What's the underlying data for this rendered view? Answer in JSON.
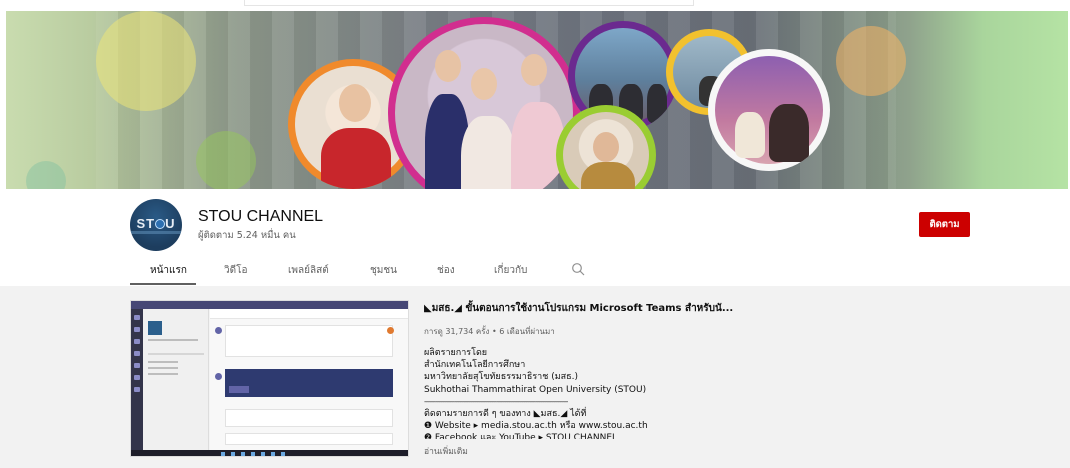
{
  "channel": {
    "name": "STOU CHANNEL",
    "subscribers": "ผู้ติดตาม 5.24 หมื่น คน",
    "subscribe_label": "ติดตาม",
    "avatar_text": "ST  U"
  },
  "tabs": [
    {
      "label": "หน้าแรก",
      "active": true
    },
    {
      "label": "วิดีโอ"
    },
    {
      "label": "เพลย์ลิสต์"
    },
    {
      "label": "ชุมชน"
    },
    {
      "label": "ช่อง"
    },
    {
      "label": "เกี่ยวกับ"
    }
  ],
  "featured_video": {
    "title": "◣มสธ.◢ ขั้นตอนการใช้งานโปรแกรม Microsoft Teams สำหรับนั...",
    "meta": "การดู 31,734 ครั้ง • 6 เดือนที่ผ่านมา",
    "description": [
      "ผลิตรายการโดย",
      "สำนักเทคโนโลยีการศึกษา",
      "มหาวิทยาลัยสุโขทัยธรรมาธิราช (มสธ.)",
      "Sukhothai Thammathirat Open University (STOU)",
      "----------------------------------------------------------------------------",
      "ติดตามรายการดี ๆ ของทาง ◣มสธ.◢ ได้ที่",
      "❶ Website ▸ media.stou.ac.th หรือ www.stou.ac.th",
      "❷ Facebook และ YouTube ▸ STOU CHANNEL"
    ],
    "read_more": "อ่านเพิ่มเติม"
  },
  "colors": {
    "subscribe": "#cc0000",
    "teams_header": "#464775",
    "content_bg": "#f2f2f2"
  },
  "icons": [
    "search-icon",
    "channel-avatar"
  ]
}
